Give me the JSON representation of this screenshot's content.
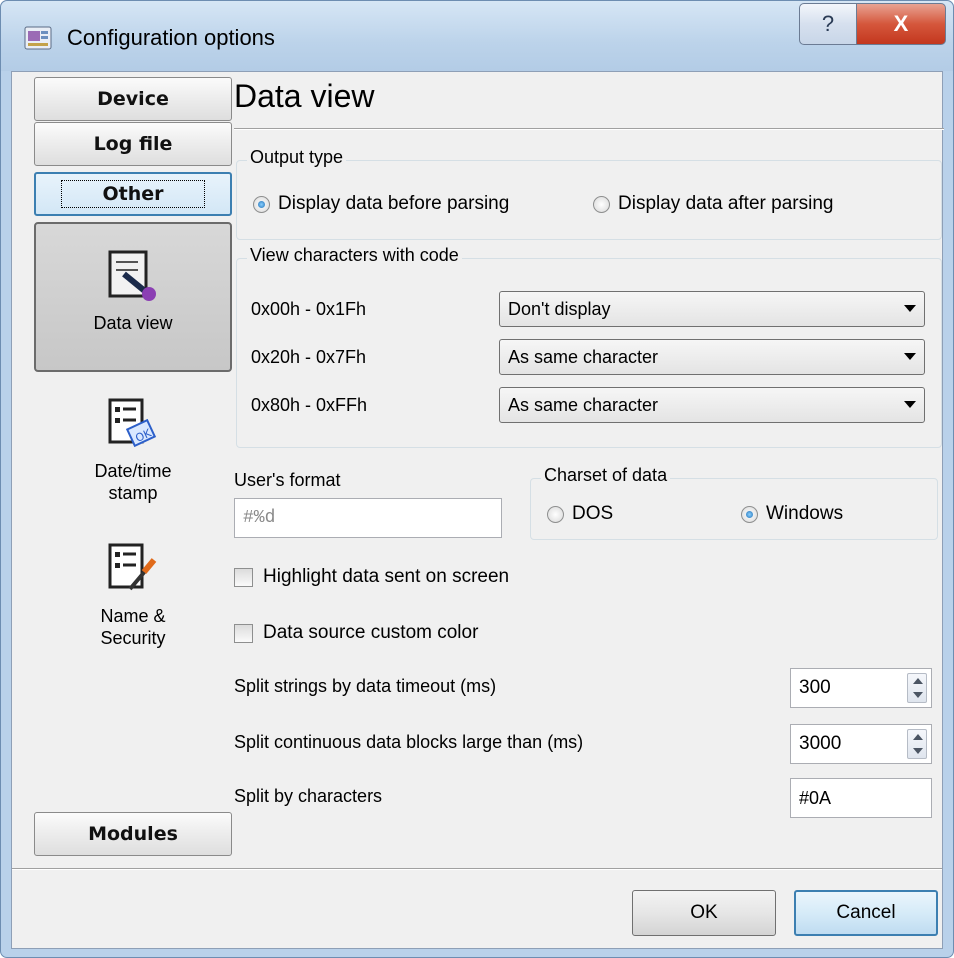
{
  "window": {
    "title": "Configuration options",
    "help_glyph": "?",
    "close_glyph": "X"
  },
  "sidebar": {
    "device": "Device",
    "log_file": "Log file",
    "other": "Other",
    "modules": "Modules",
    "items": [
      {
        "label": "Data view",
        "icon": "data-view-icon"
      },
      {
        "label": "Date/time stamp",
        "icon": "date-time-stamp-icon"
      },
      {
        "label": "Name & Security",
        "icon": "name-security-icon"
      }
    ]
  },
  "main": {
    "heading": "Data view",
    "output_type": {
      "title": "Output type",
      "option_before": "Display data before parsing",
      "option_after": "Display data after parsing",
      "selected": "before"
    },
    "view_chars": {
      "title": "View characters with code",
      "rows": [
        {
          "range": "0x00h - 0x1Fh",
          "value": "Don't display"
        },
        {
          "range": "0x20h - 0x7Fh",
          "value": "As same character"
        },
        {
          "range": "0x80h - 0xFFh",
          "value": "As same character"
        }
      ]
    },
    "users_format": {
      "label": "User's format",
      "placeholder": "#%d"
    },
    "charset": {
      "title": "Charset of data",
      "option_dos": "DOS",
      "option_windows": "Windows",
      "selected": "windows"
    },
    "highlight_label": "Highlight data sent on screen",
    "custom_color_label": "Data source custom color",
    "split_timeout": {
      "label": "Split strings by data timeout (ms)",
      "value": "300"
    },
    "split_blocks": {
      "label": "Split continuous data blocks large than (ms)",
      "value": "3000"
    },
    "split_chars": {
      "label": "Split by characters",
      "value": "#0A"
    }
  },
  "footer": {
    "ok": "OK",
    "cancel": "Cancel"
  }
}
